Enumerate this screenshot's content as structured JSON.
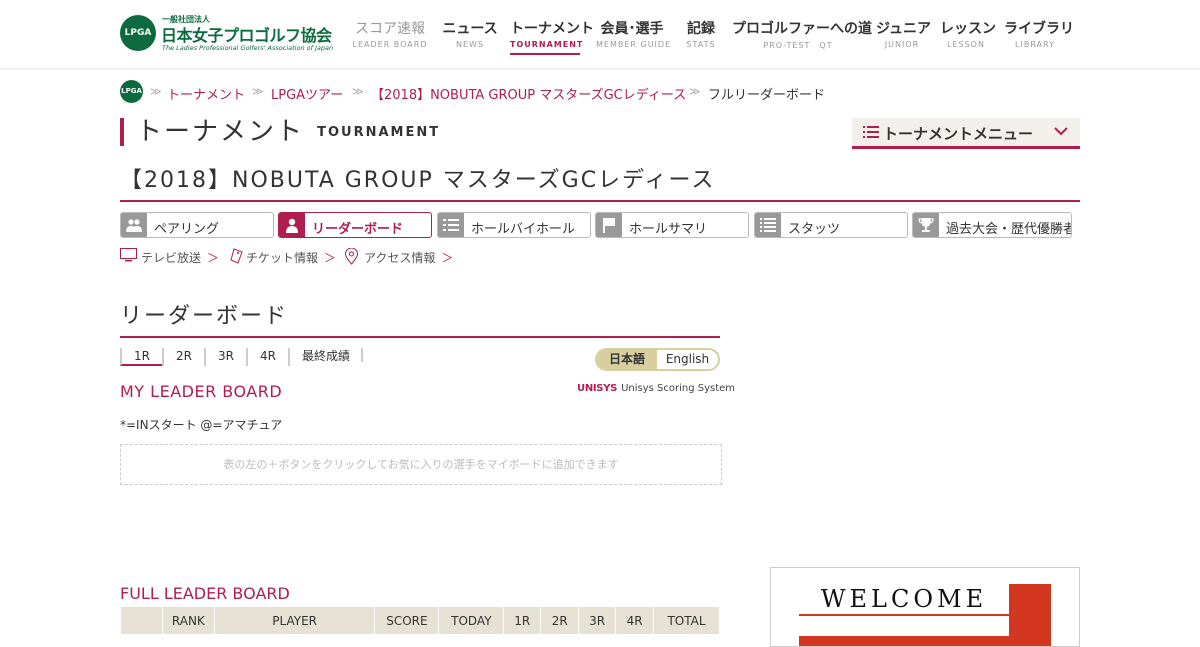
{
  "header": {
    "logo": {
      "mark_text": "LPGA",
      "small_text": "一般社団法人",
      "main_text": "日本女子プロゴルフ協会",
      "sub_text": "The Ladies Professional Golfers' Association of Japan"
    },
    "nav": [
      {
        "jp": "スコア速報",
        "en": "LEADER BOARD",
        "state": "disabled"
      },
      {
        "jp": "ニュース",
        "en": "NEWS",
        "state": ""
      },
      {
        "jp": "トーナメント",
        "en": "TOURNAMENT",
        "state": "active"
      },
      {
        "jp": "会員･選手",
        "en": "MEMBER GUIDE",
        "state": ""
      },
      {
        "jp": "記録",
        "en": "STATS",
        "state": ""
      },
      {
        "jp": "プロゴルファーへの道",
        "en": "PRO-TEST　QT",
        "state": ""
      },
      {
        "jp": "ジュニア",
        "en": "JUNIOR",
        "state": ""
      },
      {
        "jp": "レッスン",
        "en": "LESSON",
        "state": ""
      },
      {
        "jp": "ライブラリ",
        "en": "LIBRARY",
        "state": ""
      }
    ]
  },
  "breadcrumb": {
    "home": "LPGA",
    "items": [
      "トーナメント",
      "LPGAツアー",
      "【2018】NOBUTA GROUP マスターズGCレディース",
      "フルリーダーボード"
    ]
  },
  "page": {
    "title_jp": "トーナメント",
    "title_en": "TOURNAMENT",
    "menu_label": "トーナメントメニュー",
    "event_title": "【2018】NOBUTA GROUP マスターズGCレディース"
  },
  "subtabs": [
    {
      "label": "ペアリング",
      "icon": "people-icon",
      "active": false
    },
    {
      "label": "リーダーボード",
      "icon": "person-icon",
      "active": true
    },
    {
      "label": "ホールバイホール",
      "icon": "list-icon",
      "active": false
    },
    {
      "label": "ホールサマリ",
      "icon": "flag-icon",
      "active": false
    },
    {
      "label": "スタッツ",
      "icon": "numbered-list-icon",
      "active": false
    },
    {
      "label": "過去大会・歴代優勝者",
      "icon": "trophy-icon",
      "active": false
    }
  ],
  "info_links": [
    {
      "label": "テレビ放送",
      "arrow": "＞",
      "icon": "tv-icon"
    },
    {
      "label": "チケット情報",
      "arrow": "＞",
      "icon": "ticket-icon"
    },
    {
      "label": "アクセス情報",
      "arrow": "＞",
      "icon": "map-pin-icon"
    }
  ],
  "leaderboard": {
    "title": "リーダーボード",
    "rounds": [
      "1R",
      "2R",
      "3R",
      "4R",
      "最終成績"
    ],
    "active_round": "1R",
    "languages": {
      "jp": "日本語",
      "en": "English",
      "active": "日本語"
    },
    "my_title": "MY LEADER BOARD",
    "unisys_mark": "UNISYS",
    "unisys_text": "Unisys Scoring System",
    "legend": "*=INスタート @=アマチュア",
    "my_empty_message": "表の左の＋ボタンをクリックしてお気に入りの選手をマイボードに追加できます",
    "full_title": "FULL LEADER BOARD",
    "columns": [
      "",
      "RANK",
      "PLAYER",
      "SCORE",
      "TODAY",
      "1R",
      "2R",
      "3R",
      "4R",
      "TOTAL"
    ]
  },
  "ad": {
    "text": "WELCOME"
  },
  "colors": {
    "accent": "#b01e4e",
    "brand_green": "#0b6b3f",
    "table_header": "#e6e1d2",
    "lang_toggle": "#d8cf9f"
  }
}
